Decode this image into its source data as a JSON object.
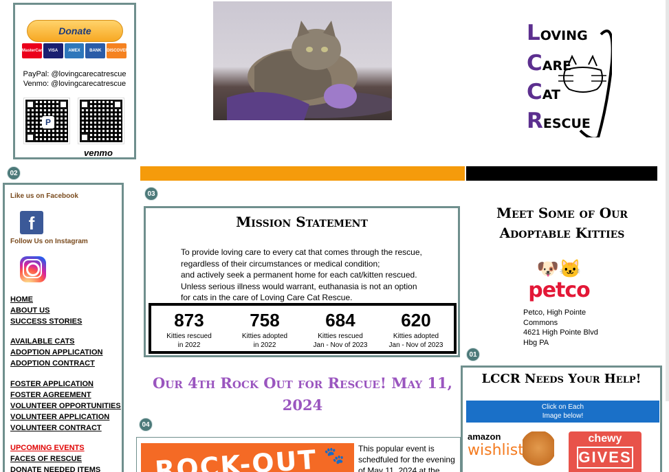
{
  "donate": {
    "button_label": "Donate",
    "cards": [
      "MasterCard",
      "VISA",
      "AMEX",
      "BANK",
      "DISCOVER"
    ],
    "paypal": "PayPal: @lovingcarecatrescue",
    "venmo": "Venmo: @lovingcarecatrescue",
    "venmo_logo": "venmo",
    "qr_center": "P",
    "icons": [
      "paypal-qr-icon",
      "venmo-qr-icon"
    ]
  },
  "logo": {
    "lines": [
      {
        "initial": "L",
        "rest": "OVING"
      },
      {
        "initial": "C",
        "rest": "ARE"
      },
      {
        "initial": "C",
        "rest": "AT"
      },
      {
        "initial": "R",
        "rest": "ESCUE"
      }
    ]
  },
  "badges": {
    "b02": "02",
    "b03": "03",
    "b04": "04",
    "b01": "01"
  },
  "sidebar": {
    "facebook_heading": "Like us on Facebook",
    "instagram_heading": "Follow Us on Instagram",
    "fb_glyph": "f",
    "nav_group1": [
      "HOME",
      "ABOUT US",
      "SUCCESS STORIES"
    ],
    "nav_group2": [
      "AVAILABLE CATS",
      "ADOPTION APPLICATION",
      "ADOPTION CONTRACT"
    ],
    "nav_group3": [
      "FOSTER APPLICATION",
      "FOSTER AGREEMENT",
      "VOLUNTEER OPPORTUNITIES",
      "VOLUNTEER APPLICATION",
      "VOLUNTEER CONTRACT"
    ],
    "nav_group4": [
      "UPCOMING EVENTS",
      "FACES OF RESCUE",
      "DONATE NEEDED ITEMS"
    ]
  },
  "mission": {
    "title": "Mission Statement",
    "lines": [
      "To provide loving care to every cat that comes through the rescue,",
      "regardless of their circumstances or medical condition;",
      "and actively seek a permanent home for each cat/kitten rescued.",
      "Unless serious illness would warrant, euthanasia is not an option",
      "for cats in the care of Loving Care Cat Rescue."
    ],
    "stats": [
      {
        "num": "873",
        "label": "Kitties rescued\nin 2022"
      },
      {
        "num": "758",
        "label": "Kitties adopted\nin 2022"
      },
      {
        "num": "684",
        "label": "Kitties rescued\nJan - Nov of 2023"
      },
      {
        "num": "620",
        "label": "Kitties adopted\nJan - Nov of 2023"
      }
    ]
  },
  "event": {
    "title": "Our 4th Rock Out for Rescue! May 11, 2024",
    "image_text": "ROCK-OUT",
    "paw": "🐾",
    "text": "This popular event is schedfuled for the evening of May 11, 2024 at the"
  },
  "right": {
    "meet_title": "Meet Some of Our Adoptable Kitties",
    "petco_pets": "🐶🐱",
    "petco_word": "petco",
    "petco_address": [
      "Petco, High Pointe",
      "Commons",
      "4621 High Pointe Blvd",
      "Hbg PA"
    ],
    "help_title": "LCCR Needs Your Help!",
    "click_lines": [
      "Click on Each",
      "Image below!"
    ],
    "amazon_1": "amazon",
    "amazon_2": "wishlist",
    "chewy_1": "chewy",
    "chewy_2": "GIVES"
  },
  "colors": {
    "orange_bar": "#f59b0b",
    "accent_purple": "#9a55bf",
    "border_teal": "#6f8f8d",
    "event_red": "#e00000"
  }
}
